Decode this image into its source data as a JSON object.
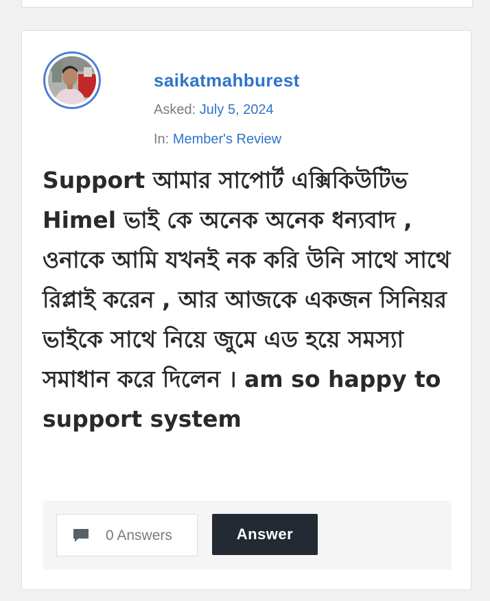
{
  "post": {
    "author": "saikatmahburest",
    "asked_label": "Asked:",
    "asked_date": "July 5, 2024",
    "in_label": "In:",
    "category": "Member's Review",
    "question_text": "Support আমার সাপোর্ট এক্সিকিউটিভ  Himel ভাই কে অনেক অনেক  ধন্যবাদ , ওনাকে আমি যখনই নক করি উনি সাথে সাথে রিপ্লাই করেন ,  আর আজকে একজন সিনিয়র ভাইকে সাথে  নিয়ে জুমে এড হয়ে  সমস্যা সমাধান করে দিলেন  । am so happy to support system"
  },
  "footer": {
    "answers_count_label": "0 Answers",
    "answer_button_label": "Answer",
    "answers_icon": "chat-bubble-icon"
  },
  "colors": {
    "link": "#2f74c9",
    "button_bg": "#232a33",
    "avatar_ring": "#4a7fd6"
  }
}
